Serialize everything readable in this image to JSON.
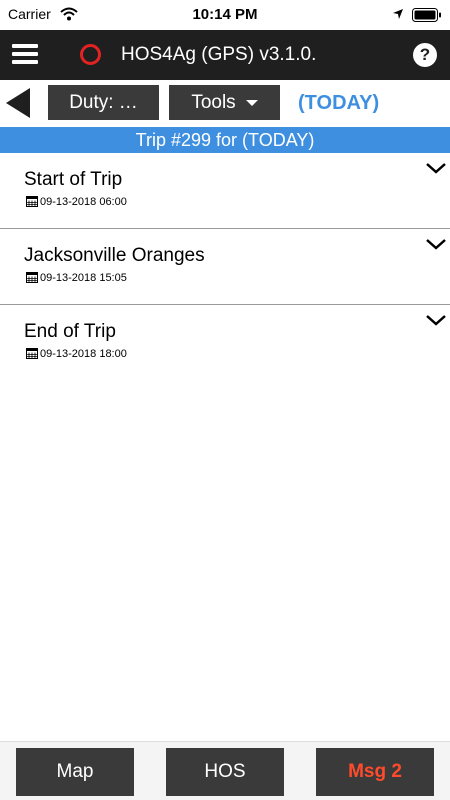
{
  "status_bar": {
    "carrier": "Carrier",
    "time": "10:14 PM",
    "icons": [
      "wifi-icon",
      "location-icon",
      "battery-icon"
    ]
  },
  "header": {
    "title": "HOS4Ag (GPS) v3.1.0.",
    "gps_status_color": "#e32222",
    "help_label": "?"
  },
  "toolbar": {
    "duty_label": "Duty: …",
    "tools_label": "Tools",
    "today_label": "(TODAY)"
  },
  "banner": {
    "text": "Trip #299 for (TODAY)"
  },
  "trip_items": [
    {
      "title": "Start of Trip",
      "datetime": "09-13-2018 06:00"
    },
    {
      "title": "Jacksonville Oranges",
      "datetime": "09-13-2018 15:05"
    },
    {
      "title": "End of Trip",
      "datetime": "09-13-2018 18:00"
    }
  ],
  "bottom_nav": {
    "map_label": "Map",
    "hos_label": "HOS",
    "msg_label": "Msg 2"
  },
  "colors": {
    "header_bg": "#1f1f1f",
    "accent_blue": "#3f8fe0",
    "button_bg": "#3a3a3a",
    "message_alert": "#ff4b2b"
  }
}
